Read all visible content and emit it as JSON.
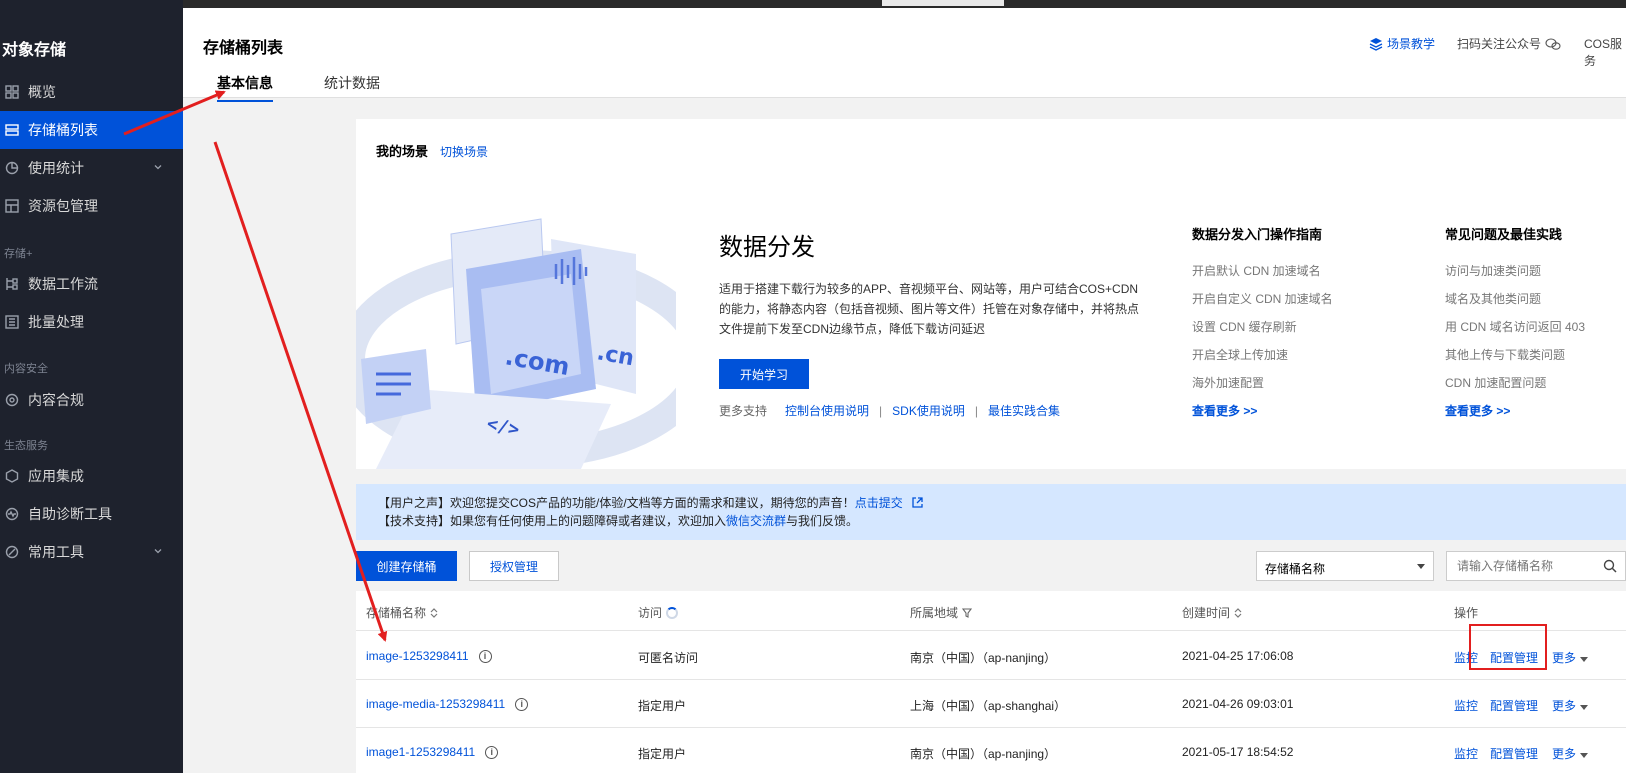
{
  "sidebar": {
    "brand": "对象存储",
    "items": [
      {
        "label": "概览",
        "icon": "grid-icon"
      },
      {
        "label": "存储桶列表",
        "icon": "bucket-list-icon",
        "active": true
      },
      {
        "label": "使用统计",
        "icon": "pie-chart-icon",
        "expandable": true
      },
      {
        "label": "资源包管理",
        "icon": "package-icon"
      },
      {
        "label": "数据工作流",
        "icon": "workflow-icon"
      },
      {
        "label": "批量处理",
        "icon": "batch-icon"
      },
      {
        "label": "内容合规",
        "icon": "shield-icon"
      },
      {
        "label": "应用集成",
        "icon": "integration-icon"
      },
      {
        "label": "自助诊断工具",
        "icon": "diagnose-icon"
      },
      {
        "label": "常用工具",
        "icon": "tools-icon",
        "expandable": true
      }
    ],
    "groups": [
      "存储+",
      "内容安全",
      "生态服务"
    ]
  },
  "header": {
    "title": "存储桶列表",
    "tabs": [
      {
        "label": "基本信息",
        "active": true
      },
      {
        "label": "统计数据"
      }
    ],
    "links": [
      "场景教学",
      "扫码关注公众号",
      "COS服务"
    ]
  },
  "scene": {
    "title": "我的场景",
    "switch": "切换场景",
    "heading": "数据分发",
    "description": "适用于搭建下载行为较多的APP、音视频平台、网站等，用户可结合COS+CDN的能力，将静态内容（包括音视频、图片等文件）托管在对象存储中，并将热点文件提前下发至CDN边缘节点，降低下载访问延迟",
    "start_button": "开始学习",
    "more_label": "更多支持",
    "more_links": [
      "控制台使用说明",
      "SDK使用说明",
      "最佳实践合集"
    ],
    "sep": "|",
    "illus_text_1": ".com",
    "illus_text_2": ".cn",
    "illus_text_3": "</>",
    "guide": {
      "title": "数据分发入门操作指南",
      "items": [
        "开启默认 CDN 加速域名",
        "开启自定义 CDN 加速域名",
        "设置 CDN 缓存刷新",
        "开启全球上传加速",
        "海外加速配置"
      ],
      "more": "查看更多 >>"
    },
    "faq": {
      "title": "常见问题及最佳实践",
      "items": [
        "访问与加速类问题",
        "域名及其他类问题",
        "用 CDN 域名访问返回 403",
        "其他上传与下载类问题",
        "CDN 加速配置问题"
      ],
      "more": "查看更多 >>"
    }
  },
  "notice": {
    "line1_prefix": "【用户之声】欢迎您提交COS产品的功能/体验/文档等方面的需求和建议，期待您的声音！",
    "line1_link": "点击提交",
    "line2_prefix": "【技术支持】如果您有任何使用上的问题障碍或者建议，欢迎加入",
    "line2_link": "微信交流群",
    "line2_suffix": "与我们反馈。"
  },
  "toolbar": {
    "create": "创建存储桶",
    "auth": "授权管理",
    "select_value": "存储桶名称",
    "search_placeholder": "请输入存储桶名称"
  },
  "table": {
    "headers": {
      "name": "存储桶名称",
      "access": "访问",
      "region": "所属地域",
      "created": "创建时间",
      "ops": "操作"
    },
    "rows": [
      {
        "name": "image-1253298411",
        "access": "可匿名访问",
        "region": "南京（中国）（ap-nanjing）",
        "created": "2021-04-25 17:06:08"
      },
      {
        "name": "image-media-1253298411",
        "access": "指定用户",
        "region": "上海（中国）（ap-shanghai）",
        "created": "2021-04-26 09:03:01"
      },
      {
        "name": "image1-1253298411",
        "access": "指定用户",
        "region": "南京（中国）（ap-nanjing）",
        "created": "2021-05-17 18:54:52"
      }
    ],
    "op_monitor": "监控",
    "op_config": "配置管理",
    "op_more": "更多"
  },
  "colors": {
    "accent": "#0052d9",
    "sidebar": "#1e222d",
    "annotation": "#e21f1f"
  }
}
